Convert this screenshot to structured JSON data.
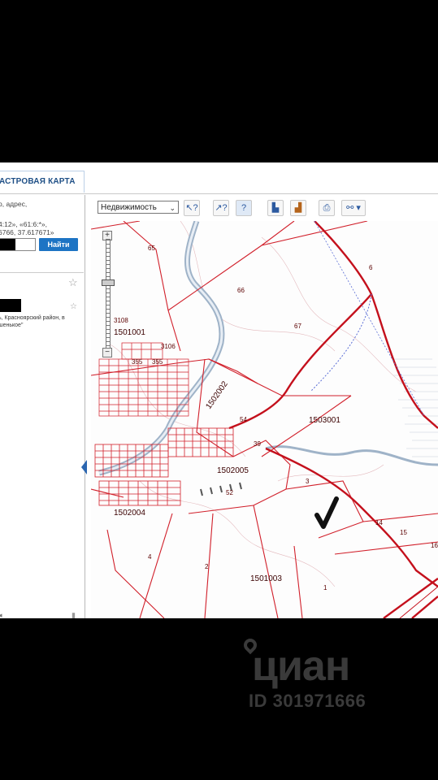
{
  "tabs": {
    "cadastre_map": "АСТРОВАЯ КАРТА"
  },
  "search": {
    "hint_lines": [
      "р, адрес,",
      ":",
      "4:12», «61:6:*»,",
      "6766, 37.617671»"
    ],
    "button_label": "Найти"
  },
  "result": {
    "address": "ь, Красноярский район, в шенькое\""
  },
  "toolbar": {
    "layer_select_value": "Недвижимость"
  },
  "map": {
    "block_labels": [
      "1501001",
      "1502002",
      "1503001",
      "1502005",
      "1502004",
      "1501003"
    ],
    "parcel_numbers": [
      "65",
      "66",
      "67",
      "6",
      "3108",
      "3106",
      "355",
      "355",
      "54",
      "39",
      "52",
      "3",
      "14",
      "15",
      "16",
      "4",
      "2",
      "1"
    ]
  },
  "watermark": {
    "brand": "циан",
    "listing_id": "ID 301971666"
  },
  "colors": {
    "cadastre_line": "#d11f2a",
    "button": "#1d74c4",
    "river": "#9fb3c8"
  }
}
